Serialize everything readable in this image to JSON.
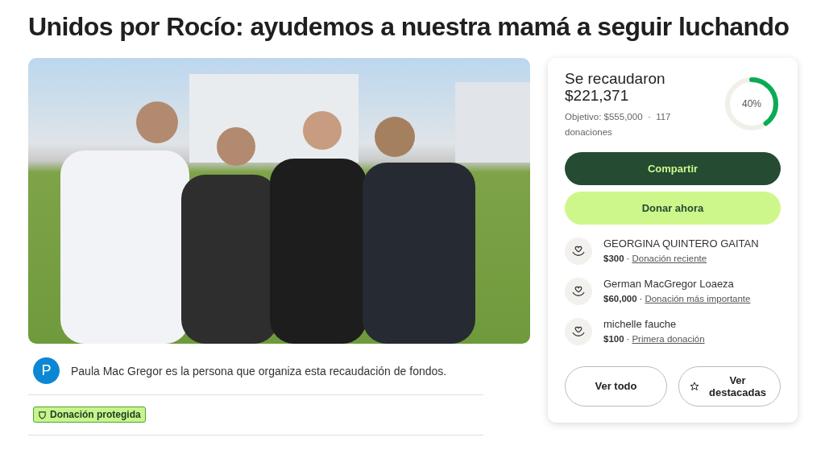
{
  "title": "Unidos por Rocío: ayudemos a nuestra mamá a seguir luchando",
  "organizer": {
    "initial": "P",
    "text": "Paula Mac Gregor es la persona que organiza esta recaudación de fondos."
  },
  "badge": "Donación protegida",
  "summary": {
    "raised_label": "Se recaudaron",
    "raised": "$221,371",
    "goal": "Objetivo: $555,000",
    "separator": "·",
    "count": "117",
    "count_label": "donaciones",
    "percent": "40%",
    "level": 0.4
  },
  "buttons": {
    "share": "Compartir",
    "donate": "Donar ahora"
  },
  "donations": [
    {
      "name": "GEORGINA QUINTERO GAITAN",
      "amount": "$300",
      "separator": "·",
      "tag": "Donación reciente"
    },
    {
      "name": "German MacGregor Loaeza",
      "amount": "$60,000",
      "separator": "·",
      "tag": "Donación más importante"
    },
    {
      "name": "michelle fauche",
      "amount": "$100",
      "separator": "·",
      "tag": "Primera donación"
    }
  ],
  "footer_buttons": [
    "Ver todo",
    "Ver destacadas"
  ]
}
